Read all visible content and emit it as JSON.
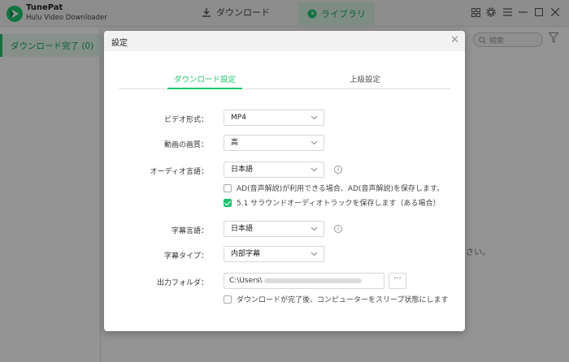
{
  "app": {
    "name": "TunePat",
    "subtitle": "Hulu Video Downloader"
  },
  "topnav": {
    "download_label": "ダウンロード",
    "library_label": "ライブラリ"
  },
  "sidebar": {
    "items": [
      {
        "label": "ダウンロード完了 (0)"
      }
    ]
  },
  "main": {
    "search_placeholder": "検索",
    "empty_text_tail": "さい。"
  },
  "dialog": {
    "title": "設定",
    "tabs": [
      {
        "label": "ダウンロード設定",
        "active": true
      },
      {
        "label": "上級設定",
        "active": false
      }
    ],
    "video_format": {
      "label": "ビデオ形式：",
      "value": "MP4"
    },
    "video_quality": {
      "label": "動画の画質：",
      "value": "高"
    },
    "audio_language": {
      "label": "オーディオ言語：",
      "value": "日本語"
    },
    "ad_option": {
      "label": "AD(音声解説)が利用できる場合、AD(音声解説)を保存します。",
      "checked": false
    },
    "surround_option": {
      "label": "5.1 サラウンドオーディオトラックを保存します（ある場合）",
      "checked": true
    },
    "subtitle_language": {
      "label": "字幕言語：",
      "value": "日本語"
    },
    "subtitle_type": {
      "label": "字幕タイプ：",
      "value": "内部字幕"
    },
    "output_folder": {
      "label": "出力フォルダ：",
      "value": "C:\\Users\\",
      "browse": "···"
    },
    "sleep_option": {
      "label": "ダウンロードが完了後、コンピューターをスリープ状態にします",
      "checked": false
    }
  },
  "colors": {
    "accent": "#22c26d",
    "accent_bg": "#e6f8ee"
  }
}
